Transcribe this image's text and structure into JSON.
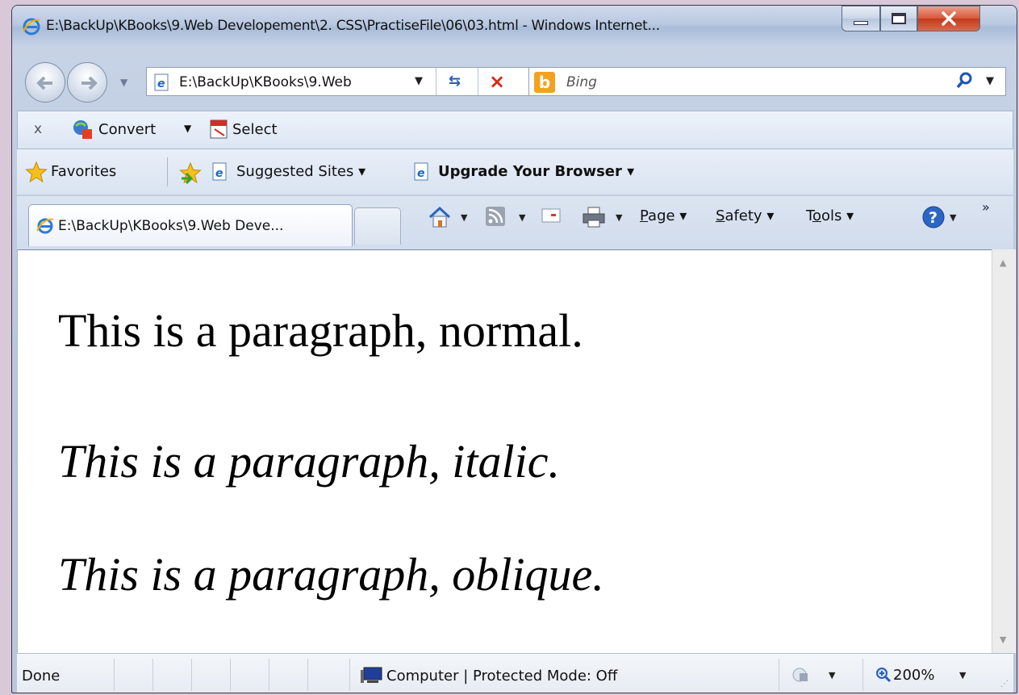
{
  "window": {
    "title": "E:\\BackUp\\KBooks\\9.Web Developement\\2. CSS\\PractiseFile\\06\\03.html - Windows Internet..."
  },
  "nav": {
    "address": "E:\\BackUp\\KBooks\\9.Web",
    "search_placeholder": "Bing"
  },
  "command_bar": {
    "close_label": "x",
    "convert_label": "Convert",
    "select_label": "Select"
  },
  "favorites_bar": {
    "favorites_label": "Favorites",
    "suggested_label": "Suggested Sites ▾",
    "upgrade_label": "Upgrade Your Browser ▾"
  },
  "tabs": {
    "active_title": "E:\\BackUp\\KBooks\\9.Web Deve..."
  },
  "toolbar": {
    "page_prefix": "",
    "page_underline": "P",
    "page_rest": "age",
    "safety_underline": "S",
    "safety_rest": "afety",
    "tools_prefix": "T",
    "tools_underline": "o",
    "tools_rest": "ols"
  },
  "content": {
    "paragraphs": [
      "This is a paragraph, normal.",
      "This is a paragraph, italic.",
      "This is a paragraph, oblique."
    ]
  },
  "status": {
    "text": "Done",
    "zone": "Computer | Protected Mode: Off",
    "zoom": "200%"
  },
  "colors": {
    "close_button": "#d9573a",
    "bing_orange": "#f3a21d",
    "stop_red": "#d52a14",
    "refresh_blue": "#2a5db8"
  }
}
